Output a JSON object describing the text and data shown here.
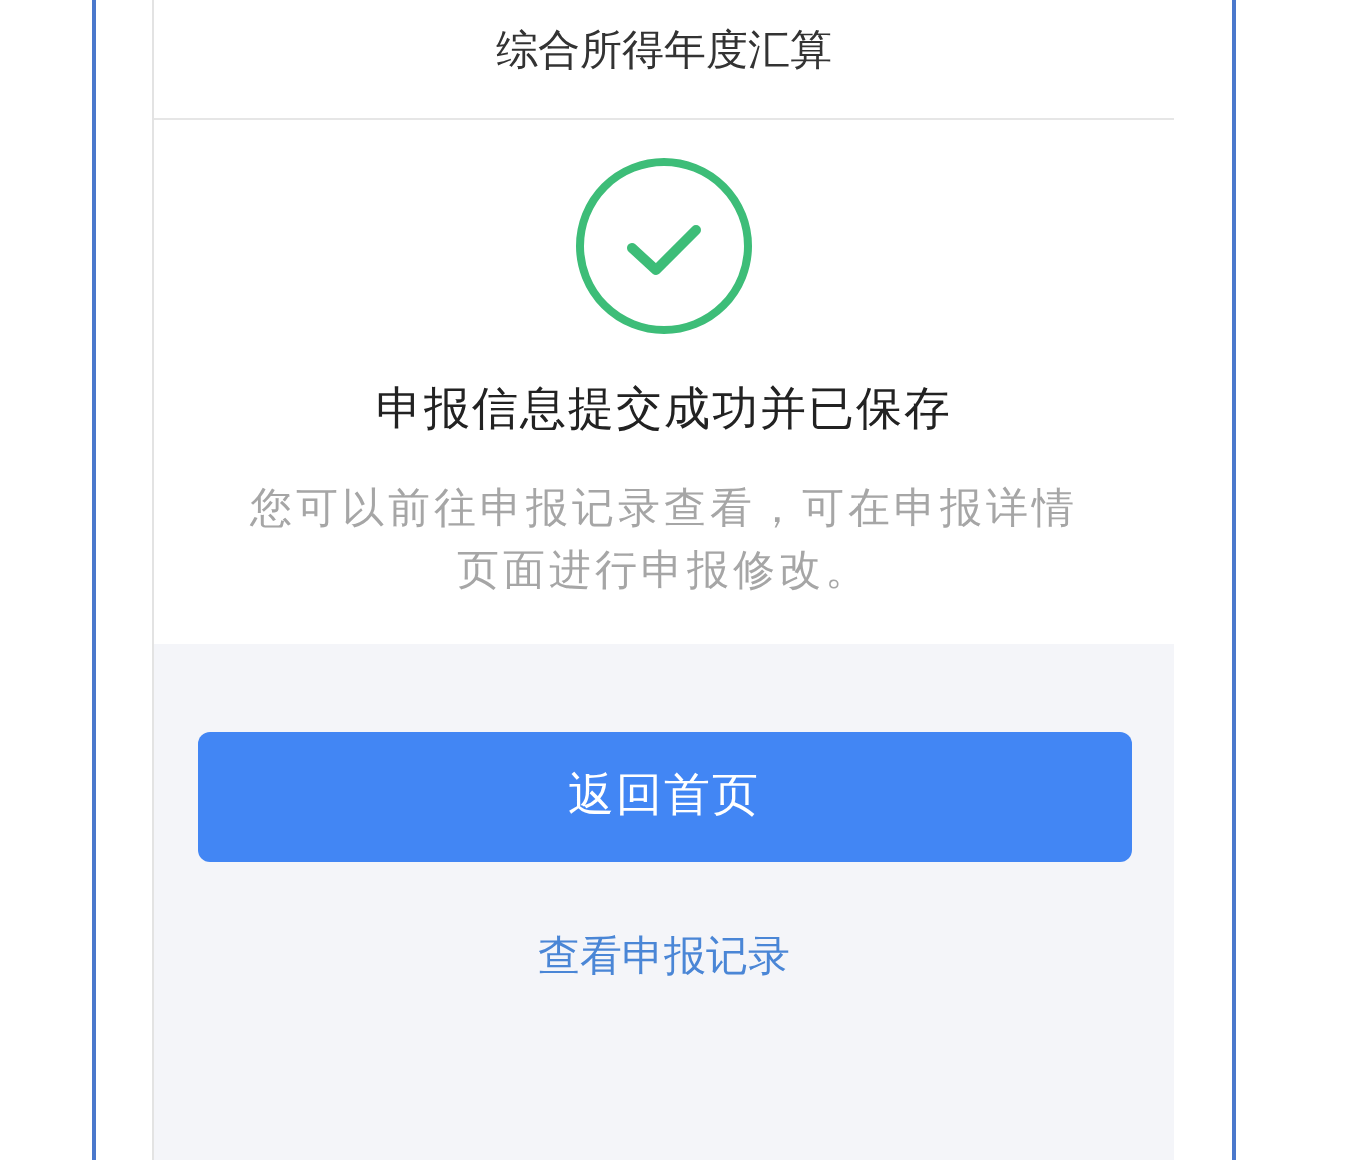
{
  "header": {
    "title": "综合所得年度汇算"
  },
  "result": {
    "title": "申报信息提交成功并已保存",
    "message": "您可以前往申报记录查看，可在申报详情页面进行申报修改。"
  },
  "actions": [
    {
      "kind": "primary",
      "label": "返回首页"
    },
    {
      "kind": "link",
      "label": "查看申报记录"
    }
  ]
}
